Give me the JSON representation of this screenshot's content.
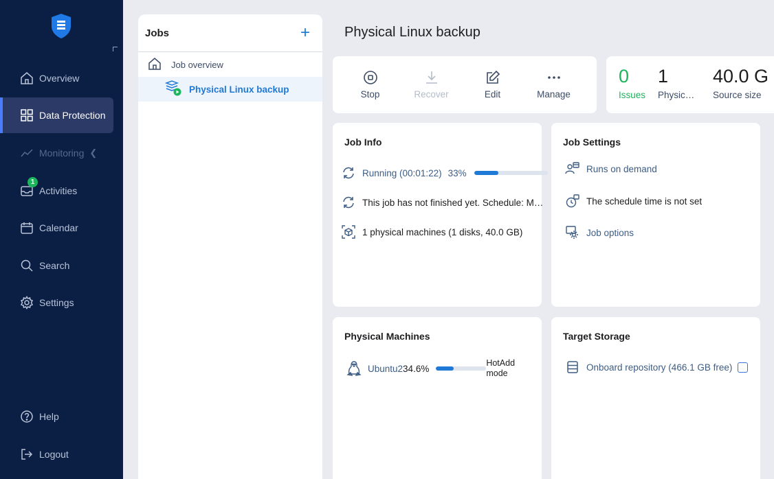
{
  "sidebar": {
    "items": [
      {
        "label": "Overview",
        "icon": "home-icon"
      },
      {
        "label": "Data Protection",
        "icon": "grid-icon"
      },
      {
        "label": "Monitoring",
        "icon": "chart-line-icon"
      },
      {
        "label": "Activities",
        "icon": "inbox-icon",
        "badge": "1"
      },
      {
        "label": "Calendar",
        "icon": "calendar-icon"
      },
      {
        "label": "Search",
        "icon": "search-icon"
      },
      {
        "label": "Settings",
        "icon": "gear-icon"
      }
    ],
    "bottom": [
      {
        "label": "Help",
        "icon": "help-icon"
      },
      {
        "label": "Logout",
        "icon": "logout-icon"
      }
    ]
  },
  "jobs": {
    "title": "Jobs",
    "add_label": "+",
    "items": [
      {
        "label": "Job overview"
      },
      {
        "label": "Physical Linux backup"
      }
    ]
  },
  "page": {
    "title": "Physical Linux backup"
  },
  "toolbar": {
    "stop": "Stop",
    "recover": "Recover",
    "edit": "Edit",
    "manage": "Manage"
  },
  "stats": {
    "issues_value": "0",
    "issues_label": "Issues",
    "physical_value": "1",
    "physical_label": "Physic…",
    "source_value": "40.0 G",
    "source_label": "Source size"
  },
  "job_info": {
    "title": "Job Info",
    "status": "Running (00:01:22)",
    "percent": "33%",
    "progress": 0.33,
    "schedule": "This job has not finished yet. Schedule: M…",
    "machines": "1 physical machines (1 disks, 40.0 GB)"
  },
  "job_settings": {
    "title": "Job Settings",
    "runs": "Runs on demand",
    "schedule_time": "The schedule time is not set",
    "options": "Job options"
  },
  "physical_machines": {
    "title": "Physical Machines",
    "machine_name": "Ubuntu2",
    "percent": "34.6%",
    "progress": 0.346,
    "mode_line1": "HotAdd",
    "mode_line2": "mode"
  },
  "target_storage": {
    "title": "Target Storage",
    "repository": "Onboard repository (466.1 GB free)"
  },
  "colors": {
    "sidebar": "#0b1f45",
    "accent": "#1f79d6",
    "success": "#1bb55c"
  }
}
